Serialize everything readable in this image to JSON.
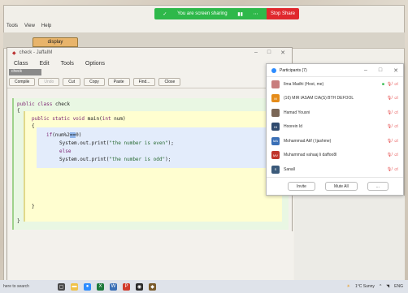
{
  "zoom_share_bar": {
    "status": "You are screen sharing",
    "stop_label": "Stop Share"
  },
  "outer_menu": [
    "Tools",
    "View",
    "Help"
  ],
  "class_tab_label": "display",
  "editor": {
    "title": "check - JaffaIM",
    "menu": [
      "Class",
      "Edit",
      "Tools",
      "Options"
    ],
    "tab": "check",
    "toolbar": [
      {
        "label": "Compile",
        "enabled": true
      },
      {
        "label": "Undo",
        "enabled": false
      },
      {
        "label": "Cut",
        "enabled": true
      },
      {
        "label": "Copy",
        "enabled": true
      },
      {
        "label": "Paste",
        "enabled": true
      },
      {
        "label": "Find...",
        "enabled": true
      },
      {
        "label": "Close",
        "enabled": true
      }
    ],
    "code": {
      "l1_kw": "public class",
      "l1_rest": " check",
      "l2": "{",
      "l3_kw": "public static void",
      "l3_rest": " main(",
      "l3_kw2": "int",
      "l3_end": " num)",
      "l4": "{",
      "l5_kw": "if",
      "l5_a": "(num%2",
      "l5_sel": "==",
      "l5_b": "0)",
      "l6_a": "System.out.print(",
      "l6_str": "\"the number is even\"",
      "l6_b": ");",
      "l7_kw": "else",
      "l8_a": "System.out.print(",
      "l8_str": "\"the number is odd\"",
      "l8_b": ");",
      "l9": "}",
      "l10": "}"
    }
  },
  "participants": {
    "title": "Participants (7)",
    "list": [
      {
        "name": "Ilma Madhi (Host, me)",
        "avatar": "",
        "color": "#c87d7d"
      },
      {
        "name": "(16) MIR IASAM CIA(S) BTH DEFOOL",
        "avatar": "M",
        "color": "#e58c1a"
      },
      {
        "name": "Hamad Yousni",
        "avatar": "",
        "color": "#7a6656"
      },
      {
        "name": "Hoorein Id",
        "avatar": "HI",
        "color": "#2f4a6e"
      },
      {
        "name": "Mohammad Atif ( Ijashme)",
        "avatar": "MA",
        "color": "#3a6fb6"
      },
      {
        "name": "Muhammad vahaaj li daffoo8l",
        "avatar": "MV",
        "color": "#c0362c"
      },
      {
        "name": "Sanall",
        "avatar": "S",
        "color": "#3b5a7a"
      }
    ],
    "invite_label": "Invite",
    "mute_all_label": "Mute All",
    "more_label": "..."
  },
  "taskbar": {
    "search_placeholder": "here to search",
    "weather": "1°C Sunny",
    "time": "ENG"
  }
}
